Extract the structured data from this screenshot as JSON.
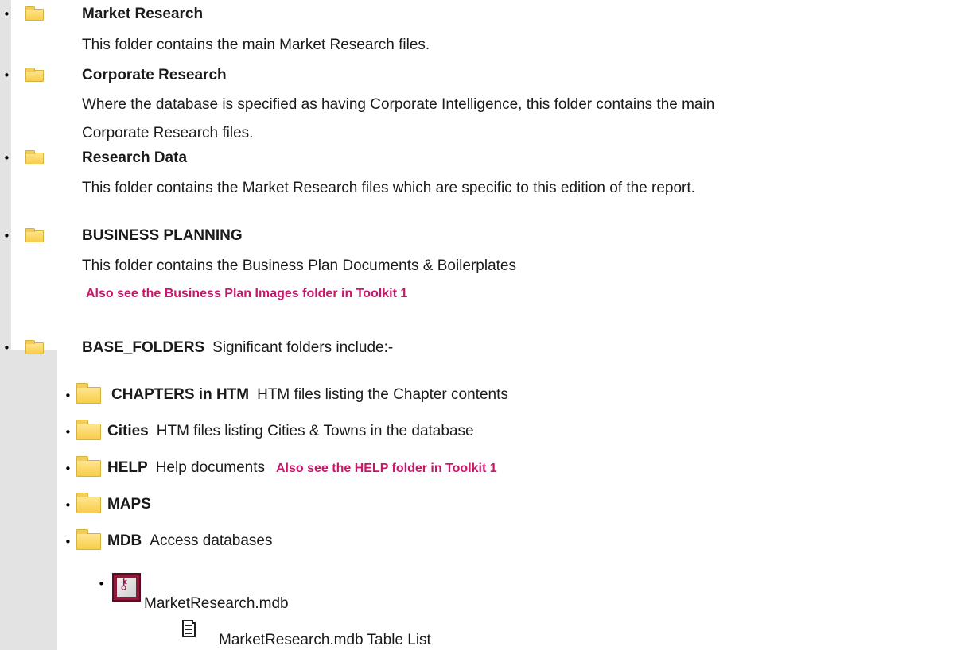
{
  "bullet_char": "•",
  "sections": [
    {
      "title": "Market Research",
      "description_lines": [
        "This folder contains the main Market Research files."
      ]
    },
    {
      "title": "Corporate Research",
      "description_lines": [
        "Where the database is specified as having Corporate Intelligence, this folder contains the main",
        "Corporate Research files."
      ]
    },
    {
      "title": "Research Data",
      "description_lines": [
        "This folder contains the Market Research files which are specific to this edition of the report."
      ]
    },
    {
      "title": "BUSINESS PLANNING",
      "description_lines": [
        "This folder contains the Business Plan Documents & Boilerplates"
      ],
      "note": "Also see the Business Plan Images folder in Toolkit 1"
    },
    {
      "title": "BASE_FOLDERS",
      "inline_description": "Significant folders include:-"
    }
  ],
  "subfolders": [
    {
      "name": "CHAPTERS in HTM",
      "description": "HTM files listing the Chapter contents"
    },
    {
      "name": "Cities",
      "description": "HTM files listing Cities & Towns in the database"
    },
    {
      "name": "HELP",
      "description": "Help documents",
      "note": "Also see the HELP folder in Toolkit 1"
    },
    {
      "name": "MAPS",
      "description": ""
    },
    {
      "name": "MDB",
      "description": "Access databases"
    }
  ],
  "files": [
    {
      "name": "MarketResearch.mdb",
      "icon": "access-database-icon"
    },
    {
      "name": "MarketResearch.mdb Table List",
      "icon": "document-icon"
    }
  ],
  "colors": {
    "note": "#c8166a",
    "folder": "#f8cd48",
    "gutter": "#e3e3e3"
  }
}
